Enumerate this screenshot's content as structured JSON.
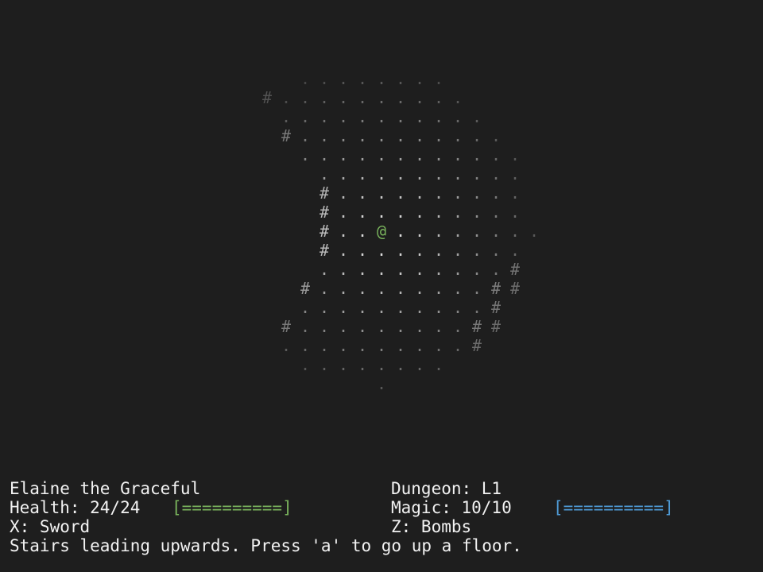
{
  "colors": {
    "background": "#1e1e1e",
    "text": "#f2f2f2",
    "player": "#79b35c",
    "health_bar": "#79b35c",
    "magic_bar": "#4f9bd6",
    "wall": "#9a9a9a",
    "floor": "#8a8a8a"
  },
  "map": {
    "player_glyph": "@",
    "wall_glyph": "#",
    "floor_glyph": "."
  },
  "status": {
    "character_name": "Elaine the Graceful",
    "dungeon": "Dungeon: L1",
    "health": "Health: 24/24",
    "health_bar": "[==========]",
    "magic": "Magic: 10/10",
    "magic_bar": "[==========]",
    "x_item": "X: Sword",
    "z_item": "Z: Bombs",
    "message": "Stairs leading upwards. Press 'a' to go up a floor."
  }
}
